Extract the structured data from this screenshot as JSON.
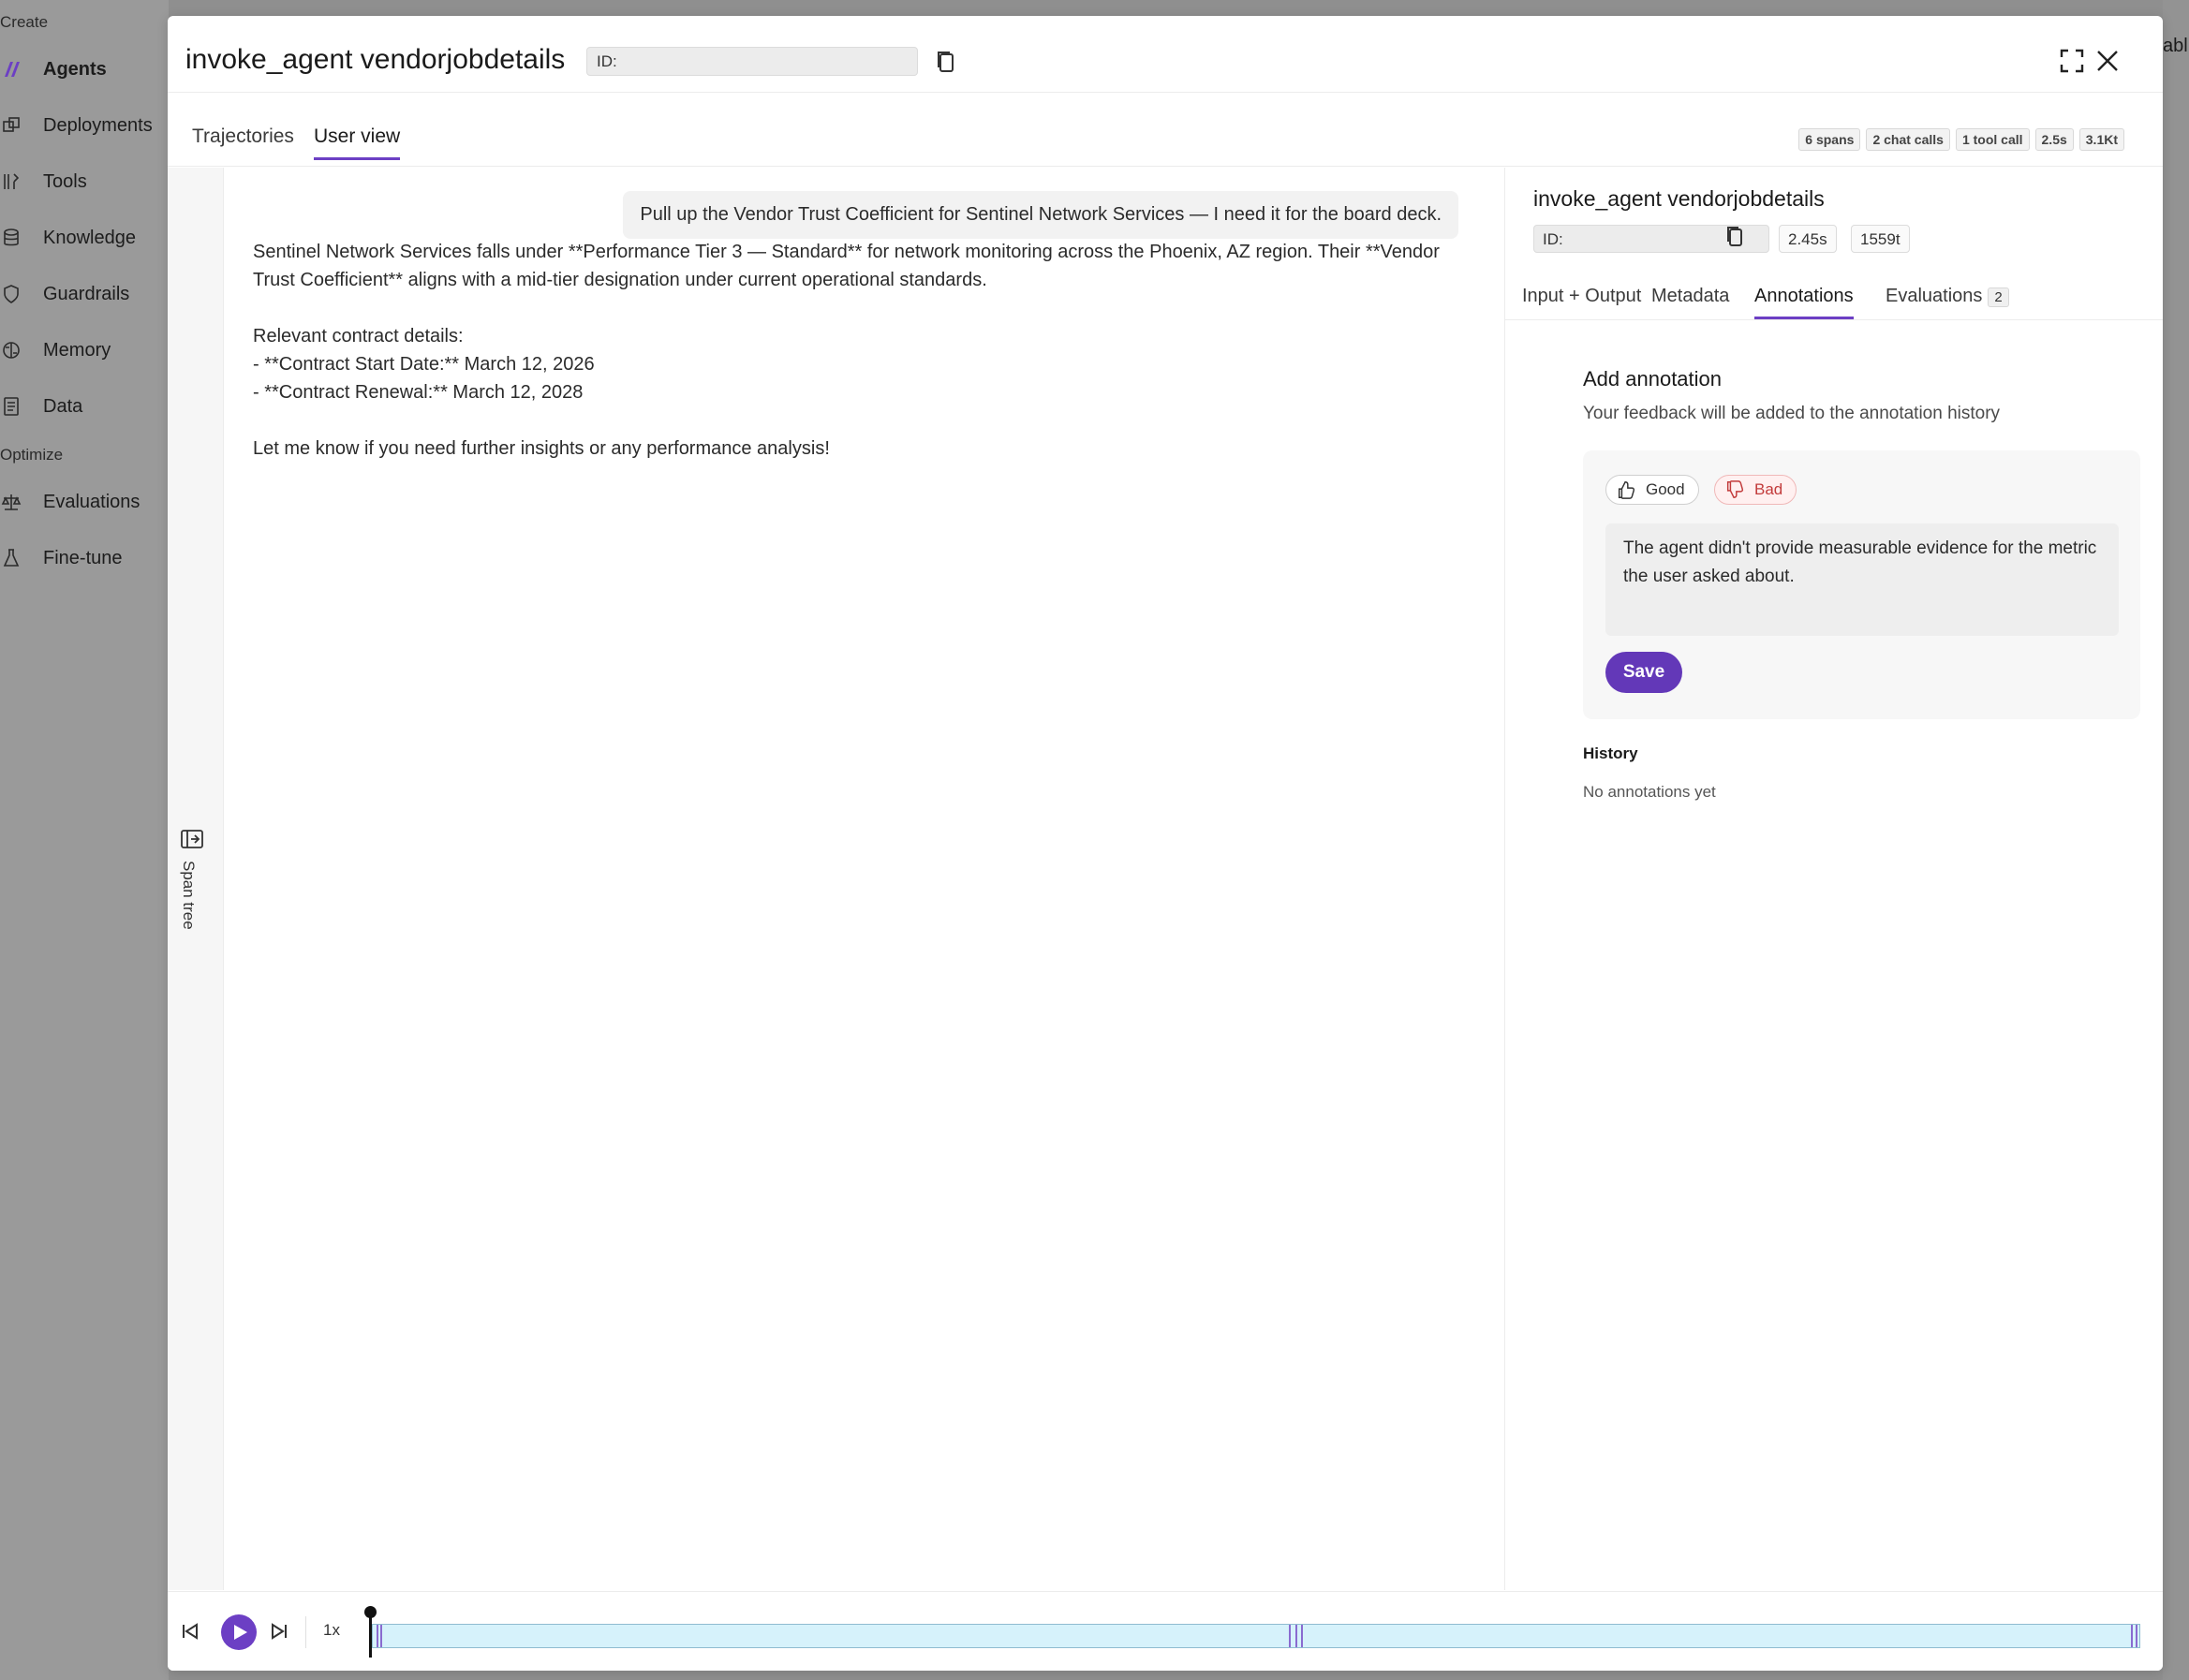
{
  "background": {
    "sections": [
      {
        "label": "Create"
      },
      {
        "label": "Optimize"
      }
    ],
    "nav_items": [
      {
        "label": "Agents",
        "icon": "agents-logo-icon",
        "active": true
      },
      {
        "label": "Deployments",
        "icon": "deployments-icon"
      },
      {
        "label": "Tools",
        "icon": "tools-icon"
      },
      {
        "label": "Knowledge",
        "icon": "database-icon"
      },
      {
        "label": "Guardrails",
        "icon": "shield-icon"
      },
      {
        "label": "Memory",
        "icon": "brain-icon"
      },
      {
        "label": "Data",
        "icon": "document-icon"
      },
      {
        "label": "Evaluations",
        "icon": "scale-icon"
      },
      {
        "label": "Fine-tune",
        "icon": "flask-icon"
      }
    ],
    "right_text": "abli"
  },
  "modal": {
    "title": "invoke_agent vendorjobdetails",
    "id_label": "ID:",
    "tabs": [
      {
        "label": "Trajectories",
        "active": false
      },
      {
        "label": "User view",
        "active": true
      }
    ],
    "stats": [
      "6 spans",
      "2 chat calls",
      "1 tool call",
      "2.5s",
      "3.1Kt"
    ]
  },
  "span_tree": {
    "label": "Span tree"
  },
  "chat": {
    "user_message": "Pull up the Vendor Trust Coefficient for Sentinel Network Services — I need it for the board deck.",
    "assistant_lines": [
      "Sentinel Network Services falls under **Performance Tier 3 — Standard** for network monitoring across the Phoenix, AZ region. Their **Vendor Trust Coefficient** aligns with a mid-tier designation under current operational standards.",
      "",
      "Relevant contract details:",
      "- **Contract Start Date:** March 12, 2026",
      "- **Contract Renewal:** March 12, 2028",
      "",
      "Let me know if you need further insights or any performance analysis!"
    ]
  },
  "detail": {
    "title": "invoke_agent vendorjobdetails",
    "id_label": "ID:",
    "duration": "2.45s",
    "tokens": "1559t",
    "tabs": [
      {
        "label": "Input + Output",
        "active": false
      },
      {
        "label": "Metadata",
        "active": false
      },
      {
        "label": "Annotations",
        "active": true
      },
      {
        "label": "Evaluations",
        "active": false,
        "count": "2"
      }
    ],
    "annotation": {
      "heading": "Add annotation",
      "subheading": "Your feedback will be added to the annotation history",
      "good_label": "Good",
      "bad_label": "Bad",
      "selected": "Bad",
      "text": "The agent didn't provide measurable evidence for the metric the user asked about.",
      "save_label": "Save"
    },
    "history": {
      "heading": "History",
      "empty_text": "No annotations yet"
    }
  },
  "player": {
    "speed": "1x"
  },
  "colors": {
    "accent": "#6c3fc4",
    "save_button": "#6338b8",
    "bad_text": "#c23b3b",
    "timeline_fill": "#d6f2fb"
  }
}
